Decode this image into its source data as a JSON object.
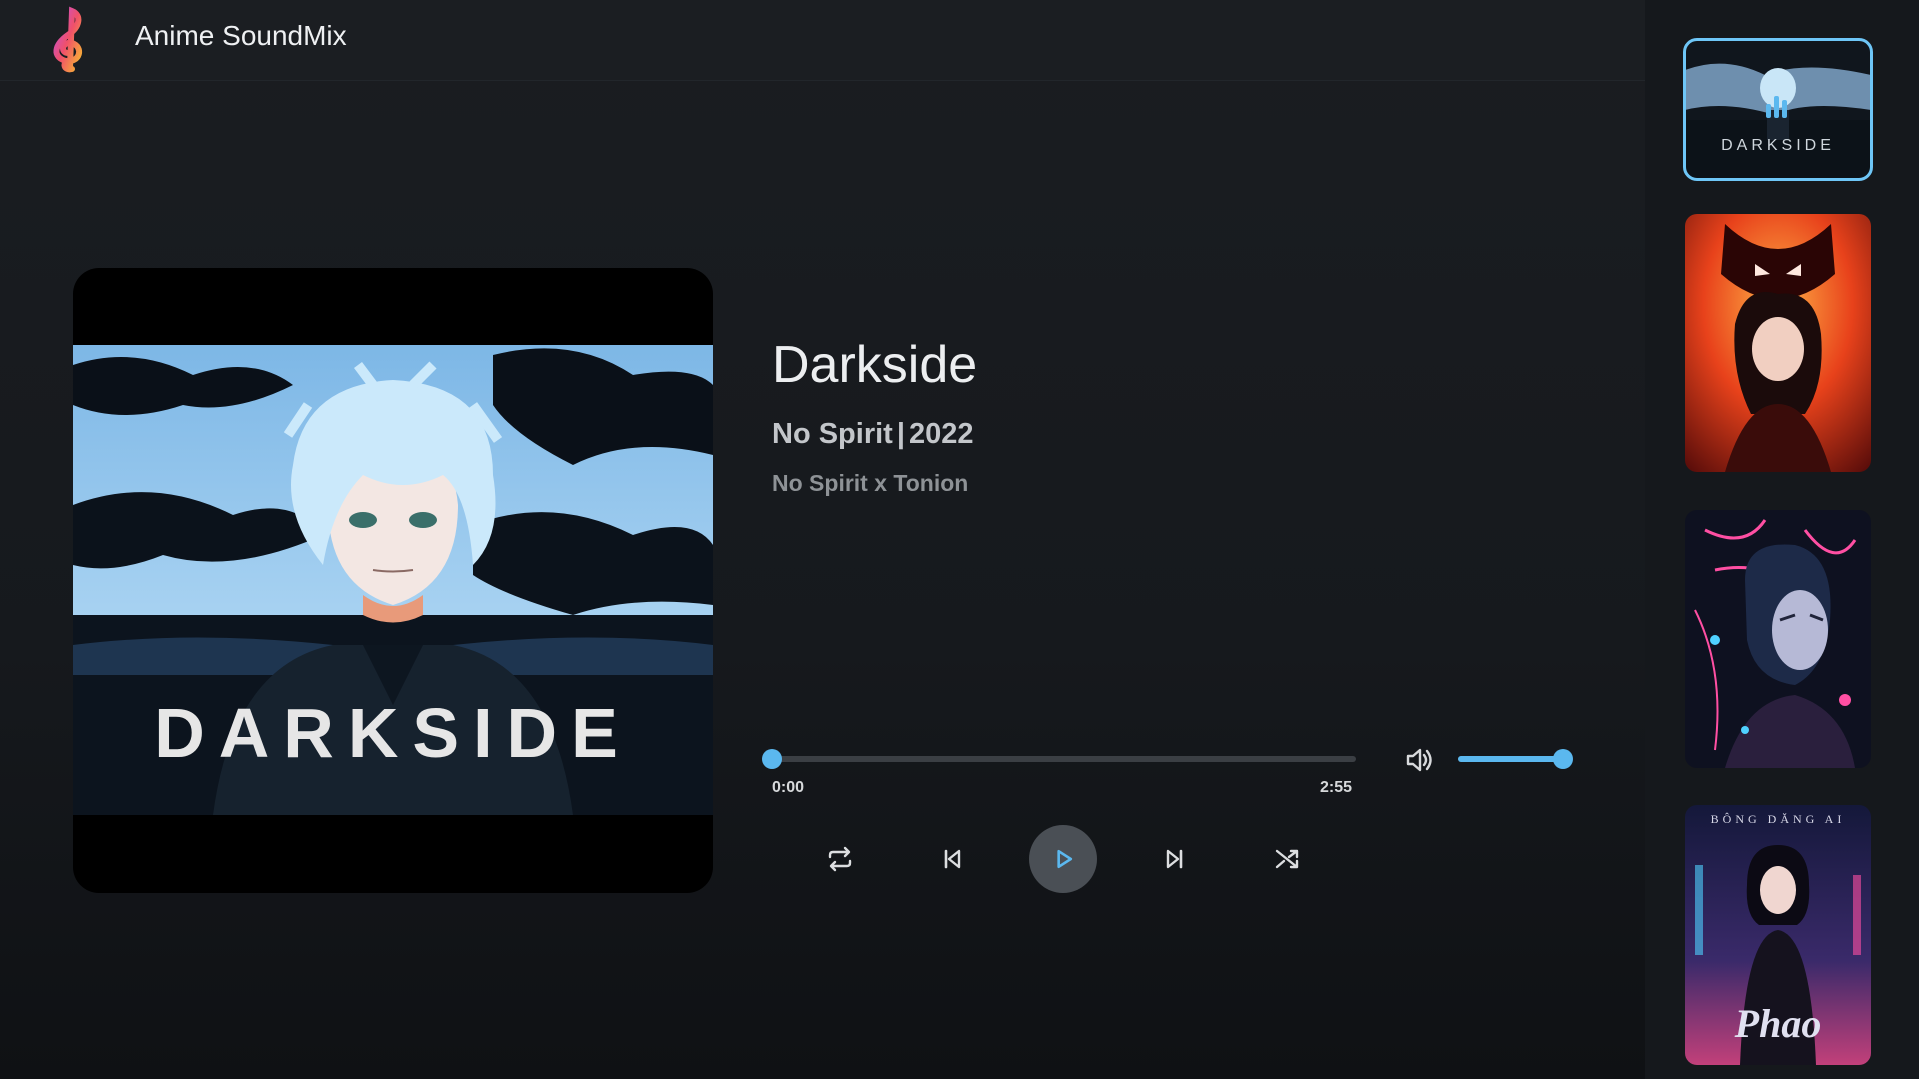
{
  "app": {
    "title": "Anime SoundMix"
  },
  "now_playing": {
    "title": "Darkside",
    "artist": "No Spirit",
    "separator": "|",
    "year": "2022",
    "credits": "No Spirit x Tonion",
    "cover_text": "DARKSIDE",
    "current_time": "0:00",
    "total_time": "2:55",
    "progress": 0.0,
    "volume": 1.0,
    "is_playing": false
  },
  "controls": [
    "repeat",
    "previous",
    "play",
    "next",
    "shuffle"
  ],
  "playlist": [
    {
      "cover_text": "DARKSIDE",
      "active": true
    },
    {
      "cover_text": "",
      "active": false
    },
    {
      "cover_text": "",
      "active": false
    },
    {
      "cover_text": "Phao",
      "cover_caption": "BÔNG DĂNG AI",
      "active": false
    }
  ],
  "colors": {
    "accent": "#5bb8ef",
    "background": "#1a1d21",
    "sidebar": "#15181c"
  }
}
